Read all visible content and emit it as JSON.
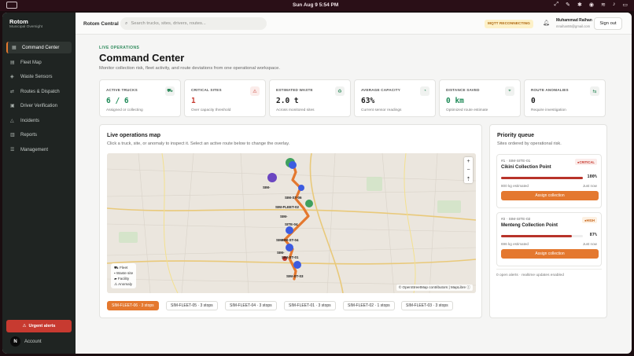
{
  "os": {
    "clock": "Sun Aug 9   5:54 PM"
  },
  "sidebar": {
    "brand_title": "Rotom",
    "brand_subtitle": "Municipal Oversight",
    "items": [
      {
        "label": "Command Center",
        "icon": "grid-icon"
      },
      {
        "label": "Fleet Map",
        "icon": "map-icon"
      },
      {
        "label": "Waste Sensors",
        "icon": "sensor-icon"
      },
      {
        "label": "Routes & Dispatch",
        "icon": "route-icon"
      },
      {
        "label": "Driver Verification",
        "icon": "id-card-icon"
      },
      {
        "label": "Incidents",
        "icon": "warning-icon"
      },
      {
        "label": "Reports",
        "icon": "chart-icon"
      },
      {
        "label": "Management",
        "icon": "sliders-icon"
      }
    ],
    "urgent_label": "Urgent alerts",
    "account_label": "Account",
    "account_badge": "N"
  },
  "topbar": {
    "title": "Rotom Central",
    "search_placeholder": "Search trucks, sites, drivers, routes...",
    "mqtt_status": "MQTT RECONNECTING",
    "user_name": "Muhammad Raihan",
    "user_email": "mraihan55@gmail.com",
    "signout_label": "Sign out"
  },
  "header": {
    "eyebrow": "LIVE OPERATIONS",
    "title": "Command Center",
    "subtitle": "Monitor collection risk, fleet activity, and route deviations from one operational workspace."
  },
  "stats": [
    {
      "label": "ACTIVE TRUCKS",
      "value": "6 / 6",
      "desc": "Assigned or collecting",
      "icon": "truck-icon",
      "tone": "green"
    },
    {
      "label": "CRITICAL SITES",
      "value": "1",
      "desc": "Over capacity threshold",
      "icon": "alert-triangle-icon",
      "tone": "red"
    },
    {
      "label": "ESTIMATED WASTE",
      "value": "2.0 t",
      "desc": "Across monitored sites",
      "icon": "recycle-icon",
      "tone": "dark"
    },
    {
      "label": "AVERAGE CAPACITY",
      "value": "63%",
      "desc": "Current sensor readings",
      "icon": "gauge-icon",
      "tone": "dark"
    },
    {
      "label": "DISTANCE SAVED",
      "value": "0 km",
      "desc": "Optimized route estimate",
      "icon": "pin-icon",
      "tone": "green"
    },
    {
      "label": "ROUTE ANOMALIES",
      "value": "0",
      "desc": "Require investigation",
      "icon": "shuffle-icon",
      "tone": "dark"
    }
  ],
  "map_panel": {
    "title": "Live operations map",
    "subtitle": "Click a truck, site, or anomaly to inspect it. Select an active route below to change the overlay.",
    "zoom_in": "+",
    "zoom_out": "−",
    "compass": "⇡",
    "legend": [
      "Fleet",
      "Waste site",
      "Facility",
      "Anomaly"
    ],
    "attribution": "© OpenStreetMap contributors | MapLibre",
    "marker_labels": [
      "SIM-",
      "SIM-FLEET-02",
      "SIM-ST-06",
      "SIM-",
      "SITE-04",
      "SIM-",
      "SIM-ST-04",
      "SIM-",
      "SIM-ST-01",
      "SIM-ST-03"
    ],
    "routes": [
      {
        "label": "SIM-FLEET-06 · 3 stops",
        "active": true
      },
      {
        "label": "SIM-FLEET-05 · 3 stops",
        "active": false
      },
      {
        "label": "SIM-FLEET-04 · 3 stops",
        "active": false
      },
      {
        "label": "SIM-FLEET-01 · 3 stops",
        "active": false
      },
      {
        "label": "SIM-FLEET-02 · 1 stops",
        "active": false
      },
      {
        "label": "SIM-FLEET-03 · 3 stops",
        "active": false
      }
    ]
  },
  "queue": {
    "title": "Priority queue",
    "subtitle": "Sites ordered by operational risk.",
    "items": [
      {
        "id": "#1 · SIM-SITE-01",
        "name": "Cikini Collection Point",
        "badge": "CRITICAL",
        "level": "crit",
        "pct_text": "100%",
        "pct": 100,
        "estimate": "800 kg estimated",
        "time": "Just now",
        "action": "Assign collection"
      },
      {
        "id": "#2 · SIM-SITE-02",
        "name": "Menteng Collection Point",
        "badge": "HIGH",
        "level": "high",
        "pct_text": "87%",
        "pct": 87,
        "estimate": "696 kg estimated",
        "time": "Just now",
        "action": "Assign collection"
      }
    ],
    "footer": "0 open alerts · realtime updates enabled"
  },
  "colors": {
    "accent": "#e4782f",
    "sidebar_bg": "#1f2422",
    "success": "#1f8a58",
    "danger": "#c73a30"
  }
}
